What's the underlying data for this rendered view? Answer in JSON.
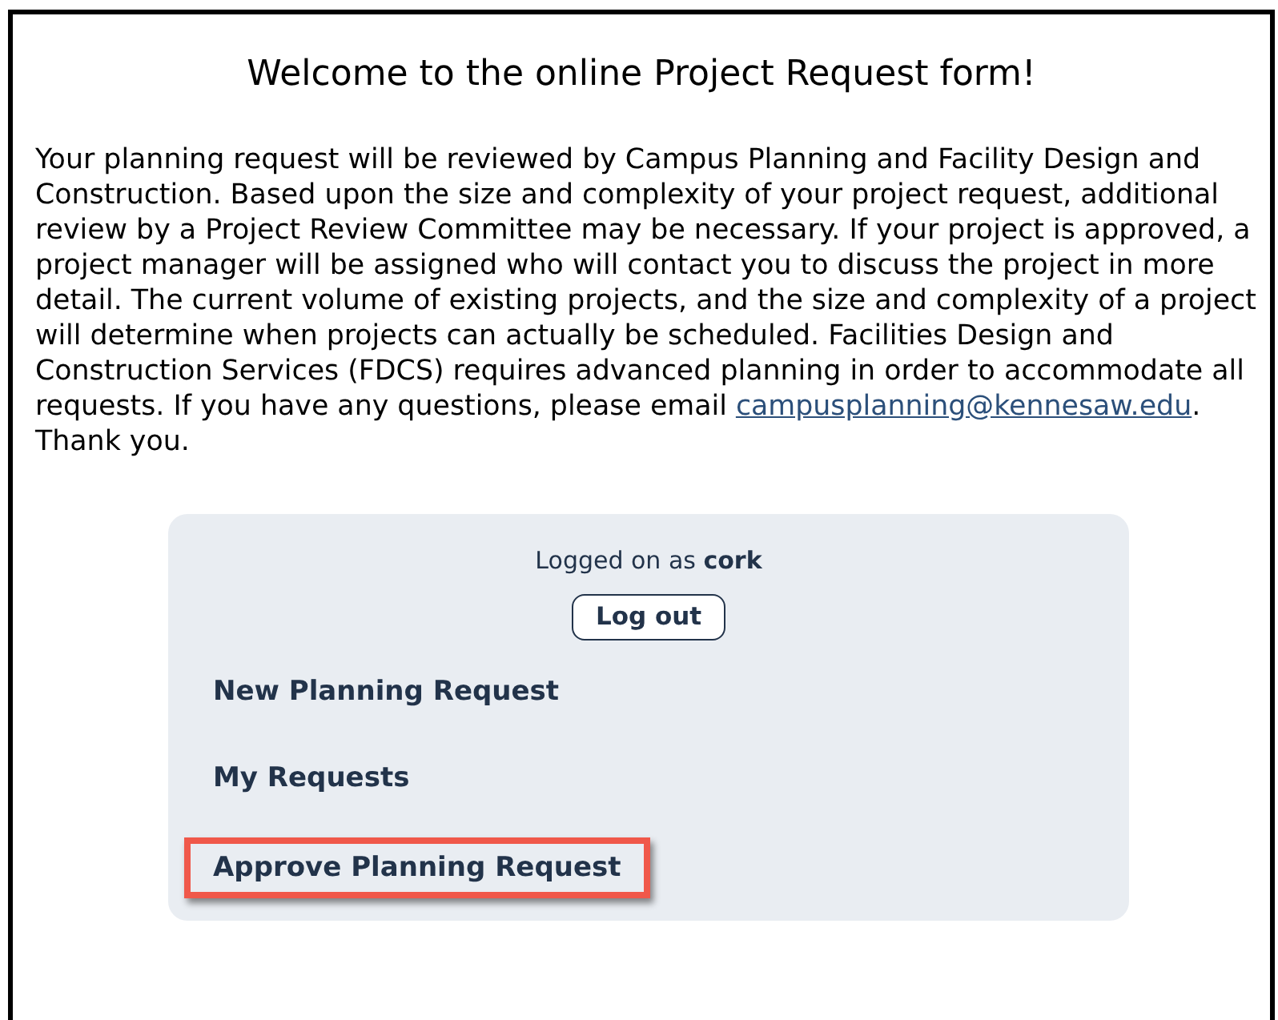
{
  "title": "Welcome to the online Project Request form!",
  "intro": {
    "before": "Your planning request will be reviewed by Campus Planning and Facility Design and Construction. Based upon the size and complexity of your project request, additional review by a Project Review Committee may be necessary. If your project is approved, a project manager will be assigned who will contact you to discuss the project in more detail. The current volume of existing projects, and the size and complexity of a project will determine when projects can actually be scheduled. Facilities Design and Construction Services (FDCS) requires advanced planning in order to accommodate all requests. If you have any questions, please email ",
    "email": "campusplanning@kennesaw.edu",
    "after": ". Thank you."
  },
  "panel": {
    "logged_on": "Logged on as **cork**",
    "logout_button": "Log out",
    "menu": [
      {
        "label": "New Planning Request",
        "highlighted": false
      },
      {
        "label": "My Requests",
        "highlighted": false
      },
      {
        "label": "Approve Planning Request",
        "highlighted": true
      }
    ]
  }
}
